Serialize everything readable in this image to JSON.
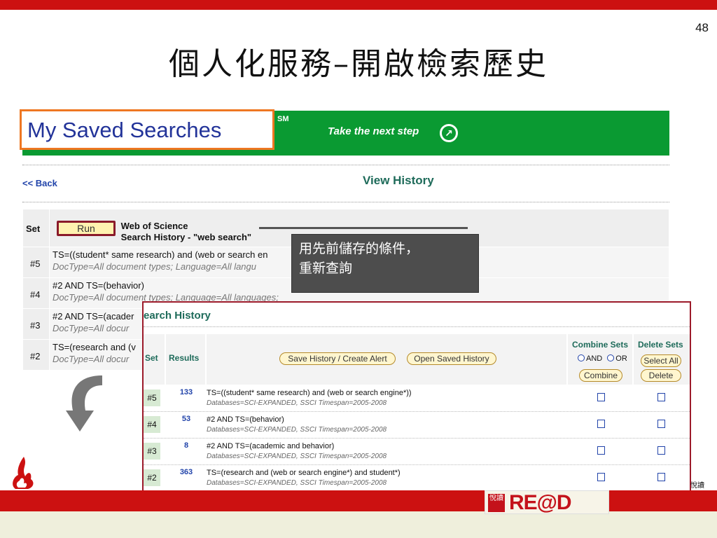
{
  "slide": {
    "page_number": "48",
    "title": "個人化服務–開啟檢索歷史",
    "saved_searches_label": "My Saved Searches",
    "callout_line1": "用先前儲存的條件，",
    "callout_line2": "重新查詢",
    "right_tag": "悅讀"
  },
  "banner": {
    "sm_mark": "SM",
    "tagline": "Take the next step",
    "arrow_icon": "arrow-circle-icon"
  },
  "history_view": {
    "back_link": "<< Back",
    "title": "View History",
    "header": {
      "set_label": "Set",
      "run_label": "Run",
      "db_line": "Web of Science",
      "history_line": "Search History - \"web search\""
    },
    "rows": [
      {
        "set": "#5",
        "query": "TS=((student* same research) and (web or search en",
        "meta": "DocType=All document types; Language=All langu"
      },
      {
        "set": "#4",
        "query": "#2 AND TS=(behavior)",
        "meta": "DocType=All document types; Language=All languages;"
      },
      {
        "set": "#3",
        "query": "#2 AND TS=(acader",
        "meta": "DocType=All docur"
      },
      {
        "set": "#2",
        "query": "TS=(research and (v",
        "meta": "DocType=All docur"
      }
    ]
  },
  "search_history": {
    "title": "earch History",
    "headers": {
      "set": "Set",
      "results": "Results",
      "save_button": "Save History / Create Alert",
      "open_button": "Open Saved History",
      "combine_sets": "Combine Sets",
      "and_label": "AND",
      "or_label": "OR",
      "combine_button": "Combine",
      "delete_sets": "Delete Sets",
      "select_all_button": "Select All",
      "delete_button": "Delete"
    },
    "rows": [
      {
        "set": "#5",
        "count": "133",
        "query": "TS=((student* same research) and (web or search engine*))",
        "meta": "Databases=SCI-EXPANDED, SSCI Timespan=2005-2008"
      },
      {
        "set": "#4",
        "count": "53",
        "query": "#2 AND TS=(behavior)",
        "meta": "Databases=SCI-EXPANDED, SSCI Timespan=2005-2008"
      },
      {
        "set": "#3",
        "count": "8",
        "query": "#2 AND TS=(academic and behavior)",
        "meta": "Databases=SCI-EXPANDED, SSCI Timespan=2005-2008"
      },
      {
        "set": "#2",
        "count": "363",
        "query": "TS=(research and (web or search engine*) and student*)",
        "meta": "Databases=SCI-EXPANDED, SSCI Timespan=2005-2008"
      }
    ]
  },
  "footer": {
    "logo_text": "RE@D",
    "logo_badge": "悅讀"
  },
  "colors": {
    "brand_red": "#cc1111",
    "banner_green": "#0a9a32",
    "highlight_orange": "#ee7722",
    "callout_gray": "#4d4d4d"
  }
}
